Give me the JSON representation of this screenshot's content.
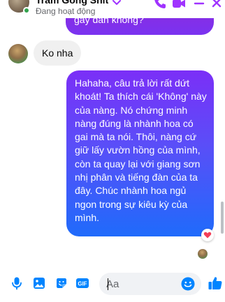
{
  "header": {
    "name": "Trâm Gồng Shit",
    "status": "Đang hoạt động"
  },
  "messages": {
    "previous_tail": "gảy đàn không?",
    "incoming": "Ko nha",
    "outgoing": "Hahaha, câu trả lời rất dứt khoát! Ta thích cái 'Không' này của nàng. Nó chứng minh nàng đúng là nhành hoa có gai mà ta nói. Thôi, nàng cứ giữ lấy vườn hồng của mình, còn ta quay lại với giang sơn nhị phân và tiếng đàn của ta đây. Chúc nhành hoa ngủ ngon trong sự kiêu kỳ của mình.",
    "outgoing_reaction": "heart-reaction"
  },
  "composer": {
    "placeholder": "Aa"
  },
  "icons": {
    "call": "phone-icon",
    "video": "video-icon",
    "minimize": "minimize-icon",
    "close": "close-icon",
    "mic": "microphone-icon",
    "image": "image-icon",
    "sticker": "sticker-icon",
    "gif": "gif-icon",
    "emoji": "emoji-icon",
    "like": "thumbs-up-icon"
  },
  "colors": {
    "accent": "#a033ff",
    "footer_accent": "#0084ff",
    "online": "#31a24c",
    "heart": "#f33e58"
  }
}
